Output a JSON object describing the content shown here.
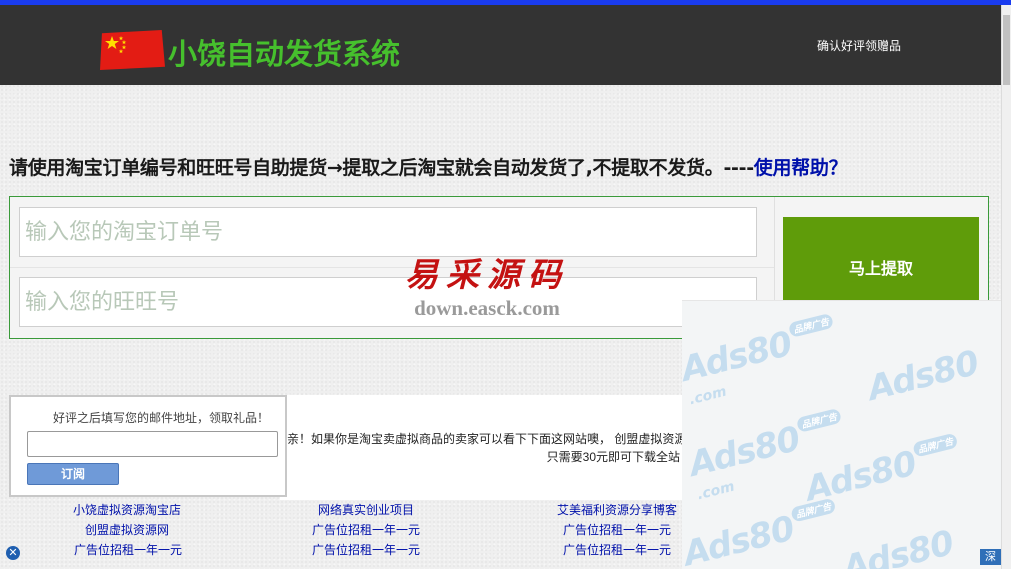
{
  "header": {
    "brand": "小饶自动发货系统",
    "link": "确认好评领赠品",
    "flag_icon": "china-flag-icon"
  },
  "instruction": {
    "text": "请使用淘宝订单编号和旺旺号自助提货→提取之后淘宝就会自动发货了,不提取不发货。----",
    "help": "使用帮助？"
  },
  "form": {
    "order_placeholder": "输入您的淘宝订单号",
    "wangwang_placeholder": "输入您的旺旺号",
    "submit_label": "马上提取"
  },
  "watermark": {
    "cn": "易采源码",
    "url": "down.easck.com"
  },
  "notice": {
    "line1": "亲！如果你是淘宝卖虚拟商品的卖家可以看下下面这网站噢， 创盟虚拟资源",
    "line2": "只需要30元即可下载全站"
  },
  "subscribe": {
    "title": "好评之后填写您的邮件地址，领取礼品！",
    "button": "订阅"
  },
  "links": {
    "col1": [
      "小饶虚拟资源淘宝店",
      "创盟虚拟资源网",
      "广告位招租一年一元"
    ],
    "col2": [
      "网络真实创业项目",
      "广告位招租一年一元",
      "广告位招租一年一元"
    ],
    "col3": [
      "艾美福利资源分享博客",
      "广告位招租一年一元",
      "广告位招租一年一元"
    ]
  },
  "ad": {
    "logo_text": "Ads80",
    "tag": "品牌广告",
    "com": ".com",
    "corner_btn": "深"
  },
  "colors": {
    "header_bg": "#333333",
    "brand_green": "#46c02d",
    "submit_green": "#5f9c0a",
    "form_border": "#3a9a3a",
    "help_link": "#0011aa",
    "top_strip": "#1a3cf0"
  }
}
